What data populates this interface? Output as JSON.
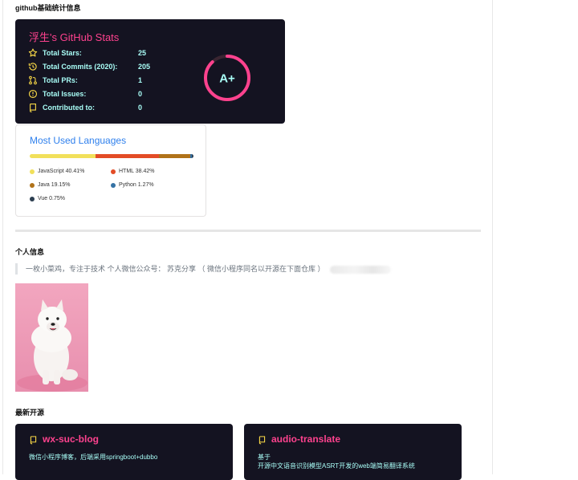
{
  "sections": {
    "github_stats_heading": "github基础统计信息",
    "personal_info_heading": "个人信息",
    "latest_open_source_heading": "最新开源"
  },
  "stats_card": {
    "title": "浮生's GitHub Stats",
    "rank": "A+",
    "rank_progress_percent": 88,
    "rows": [
      {
        "icon": "star-icon",
        "label": "Total Stars:",
        "value": "25"
      },
      {
        "icon": "history-icon",
        "label": "Total Commits (2020):",
        "value": "205"
      },
      {
        "icon": "pull-request-icon",
        "label": "Total PRs:",
        "value": "1"
      },
      {
        "icon": "issue-icon",
        "label": "Total Issues:",
        "value": "0"
      },
      {
        "icon": "repo-icon",
        "label": "Contributed to:",
        "value": "0"
      }
    ],
    "colors": {
      "background": "#141321",
      "title": "#fe428e",
      "text": "#a9fef7",
      "icon": "#f8d847"
    }
  },
  "languages_card": {
    "title": "Most Used Languages",
    "languages": [
      {
        "name": "JavaScript",
        "percent": "40.41%",
        "value": 40.41,
        "color": "#f1e05a"
      },
      {
        "name": "HTML",
        "percent": "38.42%",
        "value": 38.42,
        "color": "#e34c26"
      },
      {
        "name": "Java",
        "percent": "19.15%",
        "value": 19.15,
        "color": "#b07219"
      },
      {
        "name": "Python",
        "percent": "1.27%",
        "value": 1.27,
        "color": "#3572a5"
      },
      {
        "name": "Vue",
        "percent": "0.75%",
        "value": 0.75,
        "color": "#2c3e50"
      }
    ]
  },
  "personal_info": {
    "quote": "一枚小菜鸡，专注于技术 个人微信公众号： 苏克分享 （ 微信小程序同名以开源在下面仓库 ）"
  },
  "repos": [
    {
      "name": "wx-suc-blog",
      "description_lines": [
        "微信小程序博客，后端采用springboot+dubbo"
      ]
    },
    {
      "name": "audio-translate",
      "description_lines": [
        "基于",
        "开源中文语音识别模型ASRT开发的web端简易翻译系统"
      ]
    }
  ]
}
